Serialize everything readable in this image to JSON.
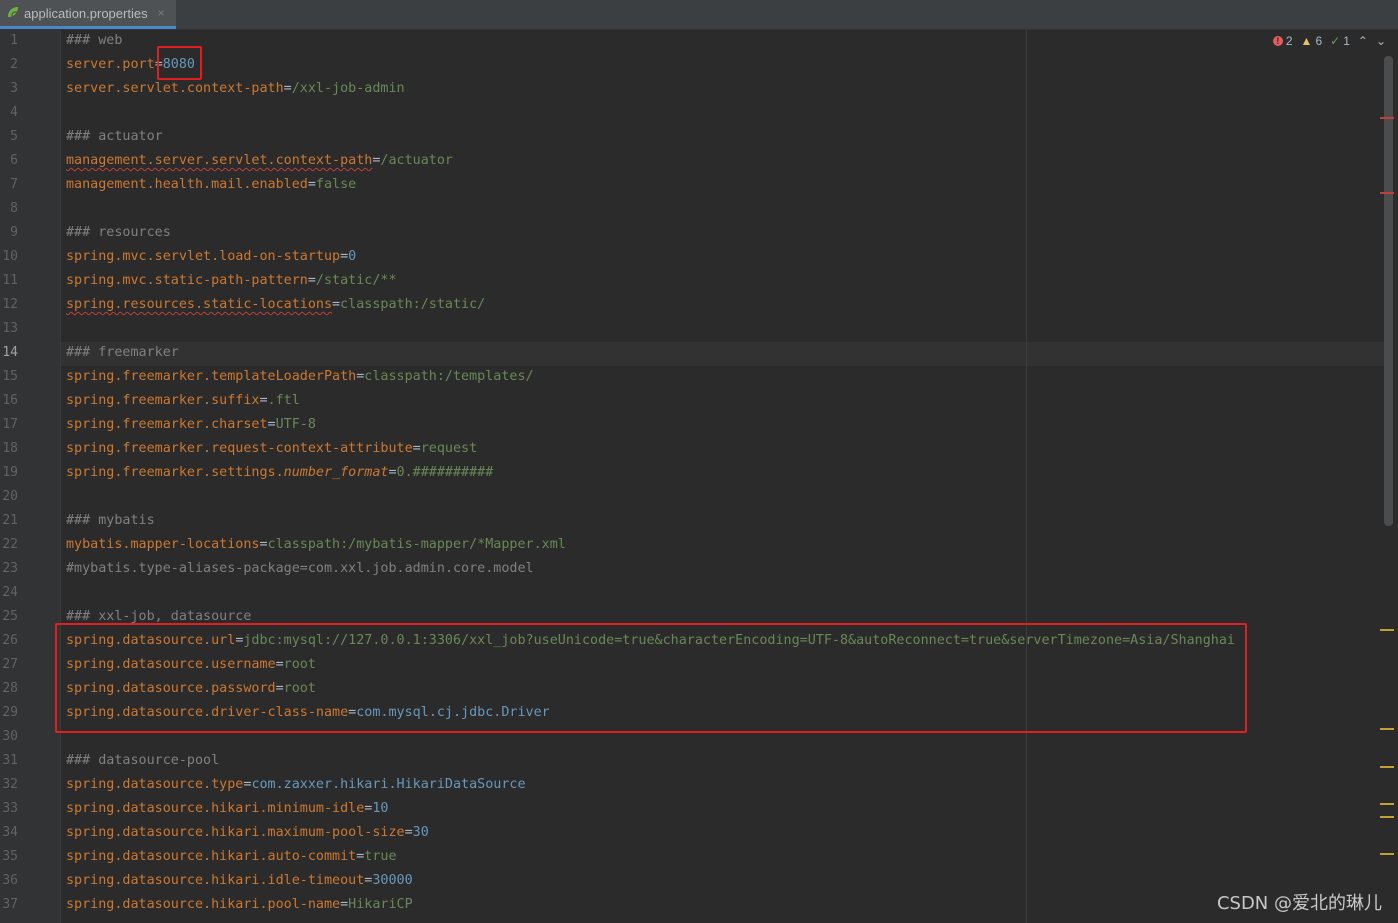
{
  "tab": {
    "file_name": "application.properties",
    "close_glyph": "×",
    "icon": "spring-leaf-icon"
  },
  "inspections": {
    "errors": "2",
    "warnings": "6",
    "weak_warnings": "1",
    "up": "⌃",
    "down": "⌄"
  },
  "current_line": "14",
  "lines": [
    {
      "num": "1",
      "c": "### web"
    },
    {
      "num": "2",
      "k": "server.port",
      "v": "8080",
      "vt": "n"
    },
    {
      "num": "3",
      "k": "server.servlet.context-path",
      "v": "/xxl-job-admin"
    },
    {
      "num": "4"
    },
    {
      "num": "5",
      "c": "### actuator"
    },
    {
      "num": "6",
      "k": "management.server.servlet.context-path",
      "v": "/actuator",
      "sq": true
    },
    {
      "num": "7",
      "k": "management.health.mail.enabled",
      "v": "false"
    },
    {
      "num": "8"
    },
    {
      "num": "9",
      "c": "### resources"
    },
    {
      "num": "10",
      "k": "spring.mvc.servlet.load-on-startup",
      "v": "0",
      "vt": "n"
    },
    {
      "num": "11",
      "k": "spring.mvc.static-path-pattern",
      "v": "/static/**"
    },
    {
      "num": "12",
      "k": "spring.resources.static-locations",
      "v": "classpath:/static/",
      "sq": true
    },
    {
      "num": "13"
    },
    {
      "num": "14",
      "c": "### freemarker"
    },
    {
      "num": "15",
      "k": "spring.freemarker.templateLoaderPath",
      "v": "classpath:/templates/"
    },
    {
      "num": "16",
      "k": "spring.freemarker.suffix",
      "v": ".ftl"
    },
    {
      "num": "17",
      "k": "spring.freemarker.charset",
      "v": "UTF-8"
    },
    {
      "num": "18",
      "k": "spring.freemarker.request-context-attribute",
      "v": "request"
    },
    {
      "num": "19",
      "k": "spring.freemarker.settings.",
      "ki": "number_format",
      "v": "0.##########"
    },
    {
      "num": "20"
    },
    {
      "num": "21",
      "c": "### mybatis"
    },
    {
      "num": "22",
      "k": "mybatis.mapper-locations",
      "v": "classpath:/mybatis-mapper/*Mapper.xml"
    },
    {
      "num": "23",
      "c": "#mybatis.type-aliases-package=com.xxl.job.admin.core.model"
    },
    {
      "num": "24"
    },
    {
      "num": "25",
      "c": "### xxl-job, datasource"
    },
    {
      "num": "26",
      "k": "spring.datasource.url",
      "v": "jdbc:mysql://127.0.0.1:3306/xxl_job?useUnicode=true&characterEncoding=UTF-8&autoReconnect=true&serverTimezone=Asia/Shanghai"
    },
    {
      "num": "27",
      "k": "spring.datasource.username",
      "v": "root"
    },
    {
      "num": "28",
      "k": "spring.datasource.password",
      "v": "root"
    },
    {
      "num": "29",
      "k": "spring.datasource.driver-class-name",
      "v": "com.mysql.cj.jdbc.Driver",
      "vt": "x"
    },
    {
      "num": "30"
    },
    {
      "num": "31",
      "c": "### datasource-pool"
    },
    {
      "num": "32",
      "k": "spring.datasource.type",
      "v": "com.zaxxer.hikari.HikariDataSource",
      "vt": "x"
    },
    {
      "num": "33",
      "k": "spring.datasource.hikari.minimum-idle",
      "v": "10",
      "vt": "n"
    },
    {
      "num": "34",
      "k": "spring.datasource.hikari.maximum-pool-size",
      "v": "30",
      "vt": "n"
    },
    {
      "num": "35",
      "k": "spring.datasource.hikari.auto-commit",
      "v": "true"
    },
    {
      "num": "36",
      "k": "spring.datasource.hikari.idle-timeout",
      "v": "30000",
      "vt": "n"
    },
    {
      "num": "37",
      "k": "spring.datasource.hikari.pool-name",
      "v": "HikariCP"
    }
  ],
  "watermark": "CSDN @爱北的琳儿",
  "colors": {
    "key": "#cc7832",
    "value": "#6a8759",
    "number": "#6897bb",
    "comment": "#808080",
    "highlight": "#e02020"
  }
}
